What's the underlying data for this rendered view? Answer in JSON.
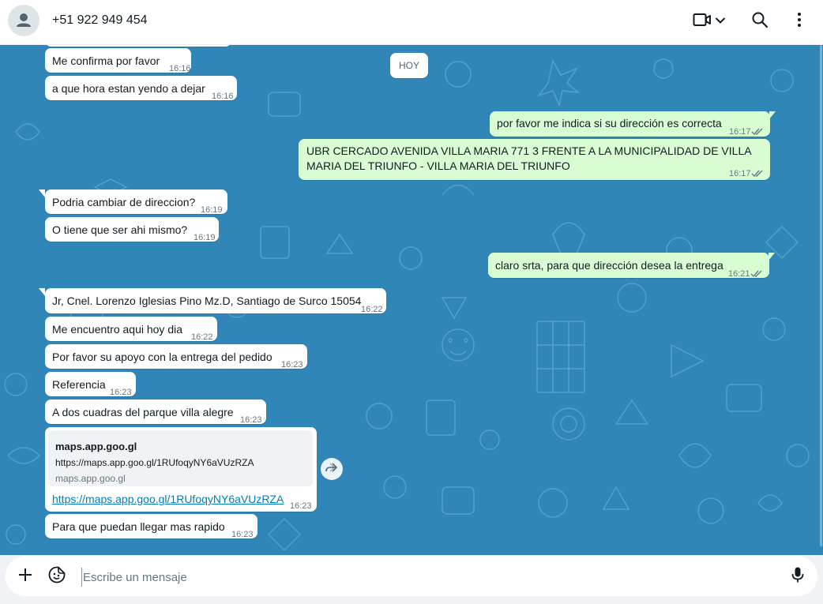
{
  "header": {
    "contact_name": "+51 922 949 454",
    "icons": [
      "avatar-icon",
      "video-call-icon",
      "chevron-down-icon",
      "search-icon",
      "menu-icon"
    ]
  },
  "chat": {
    "day_separator": "HOY",
    "messages": [
      {
        "dir": "in",
        "text": "Me confirma por favor",
        "time": "16:16"
      },
      {
        "dir": "in",
        "text": "a que hora estan yendo a dejar",
        "time": "16:16"
      },
      {
        "dir": "out",
        "text": "por favor me indica si su dirección es correcta",
        "time": "16:17",
        "status": "read"
      },
      {
        "dir": "out",
        "lines": [
          "UBR CERCADO AVENIDA VILLA MARIA 771 3 FRENTE A LA MUNICIPALIDAD DE VILLA",
          "MARIA DEL TRIUNFO - VILLA MARIA DEL TRIUNFO"
        ],
        "time": "16:17",
        "status": "read"
      },
      {
        "dir": "in",
        "text": "Podria cambiar de direccion?",
        "time": "16:19"
      },
      {
        "dir": "in",
        "text": "O tiene que ser ahi mismo?",
        "time": "16:19"
      },
      {
        "dir": "out",
        "text": "claro srta, para que dirección desea la entrega",
        "time": "16:21",
        "status": "read"
      },
      {
        "dir": "in",
        "text": "Jr, Cnel. Lorenzo Iglesias Pino Mz.D, Santiago de Surco 15054",
        "time": "16:22"
      },
      {
        "dir": "in",
        "text": "Me encuentro aqui hoy dia",
        "time": "16:22"
      },
      {
        "dir": "in",
        "text": "Por favor su apoyo con la entrega del pedido",
        "time": "16:23"
      },
      {
        "dir": "in",
        "text": "Referencia",
        "time": "16:23"
      },
      {
        "dir": "in",
        "text": "A dos cuadras del parque villa alegre",
        "time": "16:23"
      },
      {
        "dir": "in",
        "type": "link",
        "preview_title": "maps.app.goo.gl",
        "preview_url": "https://maps.app.goo.gl/1RUfoqyNY6aVUzRZA",
        "preview_domain": "maps.app.goo.gl",
        "link": "https://maps.app.goo.gl/1RUfoqyNY6aVUzRZA",
        "time": "16:23"
      },
      {
        "dir": "in",
        "text": "Para que puedan llegar mas rapido",
        "time": "16:23"
      }
    ]
  },
  "composer": {
    "placeholder": "Escribe un mensaje",
    "value": "",
    "icons": [
      "plus-icon",
      "sticker-icon",
      "microphone-icon"
    ]
  },
  "colors": {
    "chat_background": "#2f86b7",
    "incoming_bubble": "#ffffff",
    "outgoing_bubble": "#d9fdd3",
    "link": "#027eb5",
    "read_ticks": "#667781"
  }
}
